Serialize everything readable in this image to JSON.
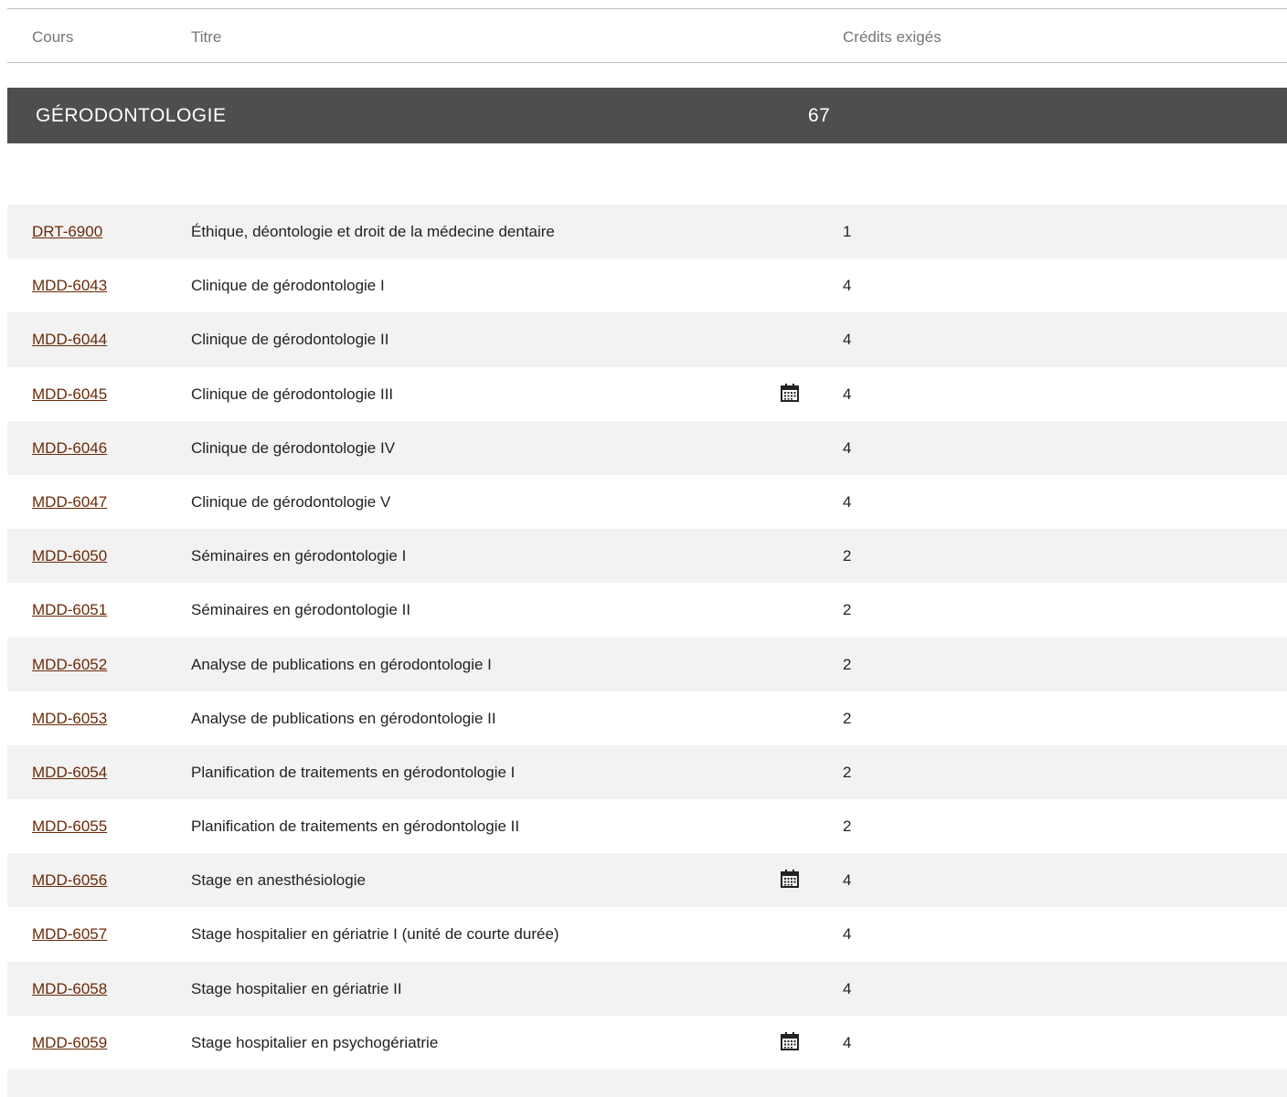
{
  "table_header": {
    "col_code": "Cours",
    "col_title": "Titre",
    "col_credits": "Crédits exigés"
  },
  "section": {
    "name": "GÉRODONTOLOGIE",
    "credits": "67"
  },
  "courses": [
    {
      "code": "DRT-6900",
      "title": "Éthique, déontologie et droit de la médecine dentaire",
      "credits": "1",
      "schedule_icon": false
    },
    {
      "code": "MDD-6043",
      "title": "Clinique de gérodontologie I",
      "credits": "4",
      "schedule_icon": false
    },
    {
      "code": "MDD-6044",
      "title": "Clinique de gérodontologie II",
      "credits": "4",
      "schedule_icon": false
    },
    {
      "code": "MDD-6045",
      "title": "Clinique de gérodontologie III",
      "credits": "4",
      "schedule_icon": true
    },
    {
      "code": "MDD-6046",
      "title": "Clinique de gérodontologie IV",
      "credits": "4",
      "schedule_icon": false
    },
    {
      "code": "MDD-6047",
      "title": "Clinique de gérodontologie V",
      "credits": "4",
      "schedule_icon": false
    },
    {
      "code": "MDD-6050",
      "title": "Séminaires en gérodontologie I",
      "credits": "2",
      "schedule_icon": false
    },
    {
      "code": "MDD-6051",
      "title": "Séminaires en gérodontologie II",
      "credits": "2",
      "schedule_icon": false
    },
    {
      "code": "MDD-6052",
      "title": "Analyse de publications en gérodontologie I",
      "credits": "2",
      "schedule_icon": false
    },
    {
      "code": "MDD-6053",
      "title": "Analyse de publications en gérodontologie II",
      "credits": "2",
      "schedule_icon": false
    },
    {
      "code": "MDD-6054",
      "title": "Planification de traitements en gérodontologie I",
      "credits": "2",
      "schedule_icon": false
    },
    {
      "code": "MDD-6055",
      "title": "Planification de traitements en gérodontologie II",
      "credits": "2",
      "schedule_icon": false
    },
    {
      "code": "MDD-6056",
      "title": "Stage en anesthésiologie",
      "credits": "4",
      "schedule_icon": true
    },
    {
      "code": "MDD-6057",
      "title": "Stage hospitalier en gériatrie I (unité de courte durée)",
      "credits": "4",
      "schedule_icon": false
    },
    {
      "code": "MDD-6058",
      "title": "Stage hospitalier en gériatrie II",
      "credits": "4",
      "schedule_icon": false
    },
    {
      "code": "MDD-6059",
      "title": "Stage hospitalier en psychogériatrie",
      "credits": "4",
      "schedule_icon": true
    }
  ],
  "colors": {
    "link": "#6b2a08",
    "section_bg": "#4e4e4e",
    "row_alt_bg": "#f2f2f2"
  },
  "icons": {
    "schedule": "calendar-icon"
  }
}
